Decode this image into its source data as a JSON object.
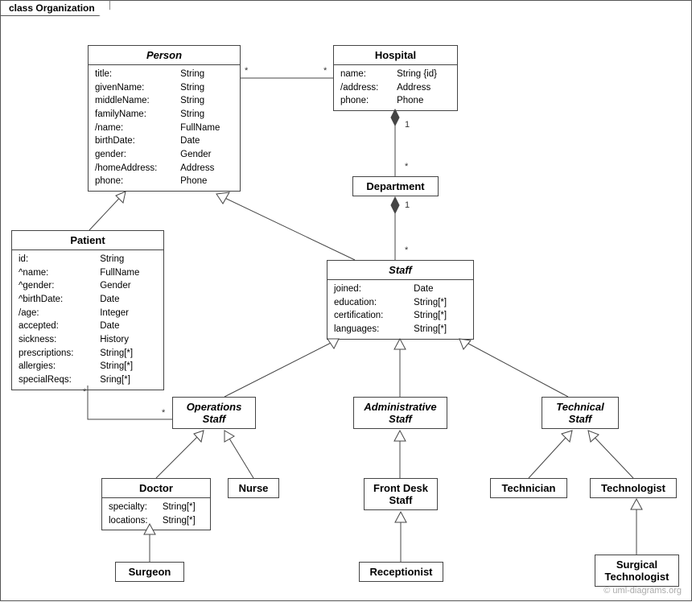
{
  "frame_label": "class Organization",
  "watermark": "© uml-diagrams.org",
  "classes": {
    "person": {
      "name": "Person",
      "attrs": [
        [
          "title:",
          "String"
        ],
        [
          "givenName:",
          "String"
        ],
        [
          "middleName:",
          "String"
        ],
        [
          "familyName:",
          "String"
        ],
        [
          "/name:",
          "FullName"
        ],
        [
          "birthDate:",
          "Date"
        ],
        [
          "gender:",
          "Gender"
        ],
        [
          "/homeAddress:",
          "Address"
        ],
        [
          "phone:",
          "Phone"
        ]
      ]
    },
    "hospital": {
      "name": "Hospital",
      "attrs": [
        [
          "name:",
          "String {id}"
        ],
        [
          "/address:",
          "Address"
        ],
        [
          "phone:",
          "Phone"
        ]
      ]
    },
    "department": {
      "name": "Department"
    },
    "patient": {
      "name": "Patient",
      "attrs": [
        [
          "id:",
          "String"
        ],
        [
          "^name:",
          "FullName"
        ],
        [
          "^gender:",
          "Gender"
        ],
        [
          "^birthDate:",
          "Date"
        ],
        [
          "/age:",
          "Integer"
        ],
        [
          "accepted:",
          "Date"
        ],
        [
          "sickness:",
          "History"
        ],
        [
          "prescriptions:",
          "String[*]"
        ],
        [
          "allergies:",
          "String[*]"
        ],
        [
          "specialReqs:",
          "Sring[*]"
        ]
      ]
    },
    "staff": {
      "name": "Staff",
      "attrs": [
        [
          "joined:",
          "Date"
        ],
        [
          "education:",
          "String[*]"
        ],
        [
          "certification:",
          "String[*]"
        ],
        [
          "languages:",
          "String[*]"
        ]
      ]
    },
    "ops_staff": {
      "name": "Operations\nStaff"
    },
    "admin_staff": {
      "name": "Administrative\nStaff"
    },
    "tech_staff": {
      "name": "Technical\nStaff"
    },
    "doctor": {
      "name": "Doctor",
      "attrs": [
        [
          "specialty:",
          "String[*]"
        ],
        [
          "locations:",
          "String[*]"
        ]
      ]
    },
    "nurse": {
      "name": "Nurse"
    },
    "front_desk": {
      "name": "Front Desk\nStaff"
    },
    "technician": {
      "name": "Technician"
    },
    "technologist": {
      "name": "Technologist"
    },
    "surgeon": {
      "name": "Surgeon"
    },
    "receptionist": {
      "name": "Receptionist"
    },
    "surg_tech": {
      "name": "Surgical\nTechnologist"
    }
  },
  "mult": {
    "person_hosp_l": "*",
    "person_hosp_r": "*",
    "hosp_dept": "1",
    "dept_top": "*",
    "dept_staff_top": "1",
    "dept_staff_bot": "*",
    "patient_ops_l": "*",
    "patient_ops_r": "*"
  }
}
